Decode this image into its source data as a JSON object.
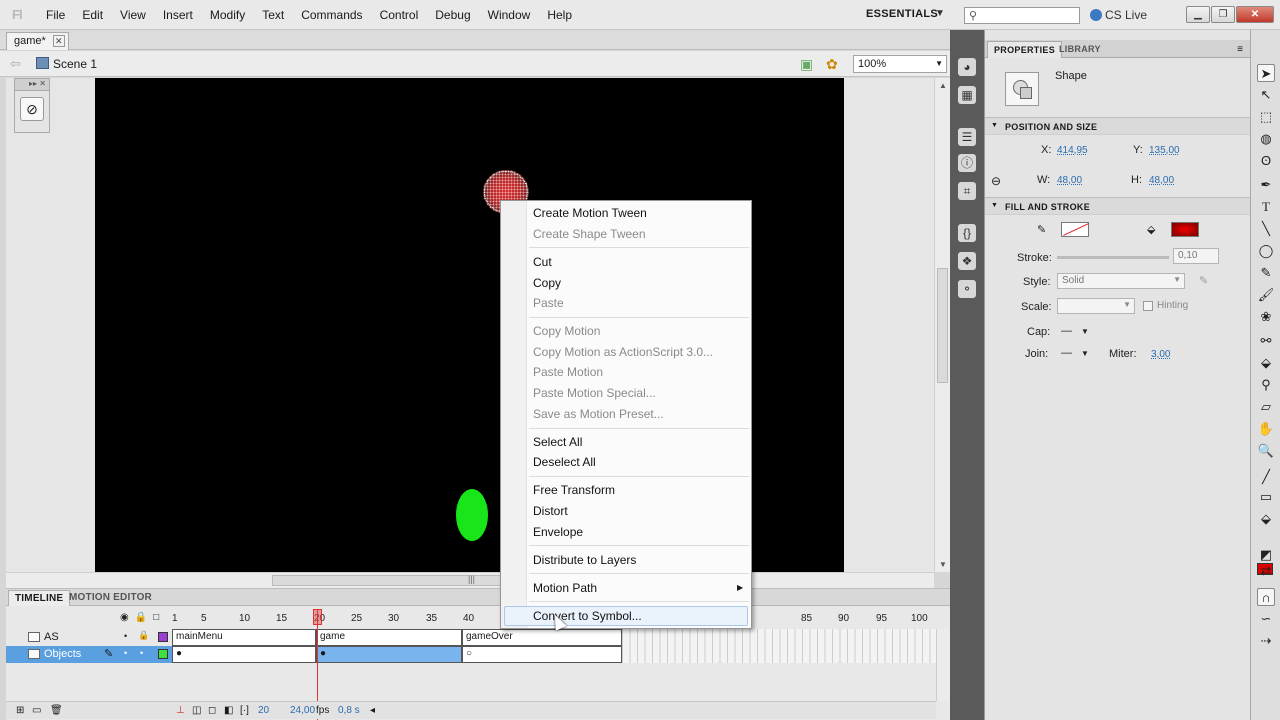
{
  "app": {
    "logo": "Fl",
    "menus": [
      "File",
      "Edit",
      "View",
      "Insert",
      "Modify",
      "Text",
      "Commands",
      "Control",
      "Debug",
      "Window",
      "Help"
    ],
    "workspace": "ESSENTIALS",
    "search_placeholder": "",
    "cs_live": "CS Live"
  },
  "document": {
    "tab": "game*",
    "scene": "Scene 1",
    "zoom": "100%"
  },
  "context_menu": {
    "items": [
      {
        "label": "Create Motion Tween",
        "enabled": true
      },
      {
        "label": "Create Shape Tween",
        "enabled": false
      },
      {
        "label": "Cut",
        "enabled": true
      },
      {
        "label": "Copy",
        "enabled": true
      },
      {
        "label": "Paste",
        "enabled": false
      },
      {
        "label": "Copy Motion",
        "enabled": false
      },
      {
        "label": "Copy Motion as ActionScript 3.0...",
        "enabled": false
      },
      {
        "label": "Paste Motion",
        "enabled": false
      },
      {
        "label": "Paste Motion Special...",
        "enabled": false
      },
      {
        "label": "Save as Motion Preset...",
        "enabled": false
      },
      {
        "label": "Select All",
        "enabled": true
      },
      {
        "label": "Deselect All",
        "enabled": true
      },
      {
        "label": "Free Transform",
        "enabled": true
      },
      {
        "label": "Distort",
        "enabled": true
      },
      {
        "label": "Envelope",
        "enabled": true
      },
      {
        "label": "Distribute to Layers",
        "enabled": true
      },
      {
        "label": "Motion Path",
        "enabled": true
      },
      {
        "label": "Convert to Symbol...",
        "enabled": true
      }
    ]
  },
  "timeline": {
    "tabs": [
      "TIMELINE",
      "MOTION EDITOR"
    ],
    "frame_numbers": [
      "1",
      "5",
      "10",
      "15",
      "20",
      "25",
      "30",
      "35",
      "40",
      "85",
      "90",
      "95",
      "100"
    ],
    "layers": [
      {
        "name": "AS",
        "color": "#9b3fd1",
        "labels": [
          "mainMenu",
          "game",
          "gameOver"
        ]
      },
      {
        "name": "Objects",
        "color": "#3ee03e",
        "selected": true
      }
    ],
    "current_frame": "20",
    "fps": "24,00",
    "fps_unit": "fps",
    "time": "0,8 s"
  },
  "properties": {
    "tabs": [
      "PROPERTIES",
      "LIBRARY"
    ],
    "object_type": "Shape",
    "sections": {
      "position_size": "POSITION AND SIZE",
      "fill_stroke": "FILL AND STROKE"
    },
    "x_label": "X:",
    "x": "414,95",
    "y_label": "Y:",
    "y": "135,00",
    "w_label": "W:",
    "w": "48,00",
    "h_label": "H:",
    "h": "48,00",
    "stroke_label": "Stroke:",
    "stroke": "0,10",
    "style_label": "Style:",
    "style": "Solid",
    "scale_label": "Scale:",
    "scale": "",
    "hinting": "Hinting",
    "cap_label": "Cap:",
    "cap": "—",
    "join_label": "Join:",
    "join": "—",
    "miter_label": "Miter:",
    "miter": "3,00",
    "fill_color": "#cc0000"
  }
}
